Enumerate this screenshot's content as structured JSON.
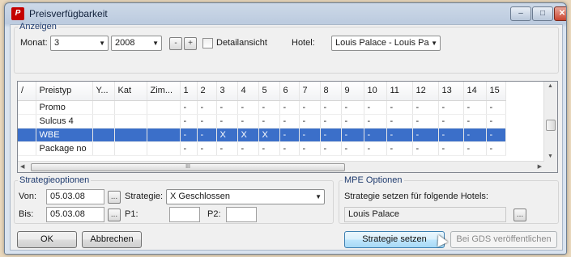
{
  "window": {
    "title": "Preisverfügbarkeit",
    "app_icon_text": "P",
    "min": "–",
    "max": "□",
    "close": "✕"
  },
  "anzeigen": {
    "legend": "Anzeigen",
    "monat_label": "Monat:",
    "monat_value": "3",
    "year_value": "2008",
    "minus": "-",
    "plus": "+",
    "detail_label": "Detailansicht",
    "hotel_label": "Hotel:",
    "hotel_value": "Louis Palace - Louis Pa"
  },
  "grid": {
    "columns": [
      "/",
      "Preistyp",
      "Y...",
      "Kat",
      "Zim...",
      "1",
      "2",
      "3",
      "4",
      "5",
      "6",
      "7",
      "8",
      "9",
      "10",
      "11",
      "12",
      "13",
      "14",
      "15"
    ],
    "rows": [
      {
        "cells": [
          "",
          "Promo",
          "",
          "",
          "",
          "-",
          "-",
          "-",
          "-",
          "-",
          "-",
          "-",
          "-",
          "-",
          "-",
          "-",
          "-",
          "-",
          "-",
          "-"
        ],
        "selected": false
      },
      {
        "cells": [
          "",
          "Sulcus 4",
          "",
          "",
          "",
          "-",
          "-",
          "-",
          "-",
          "-",
          "-",
          "-",
          "-",
          "-",
          "-",
          "-",
          "-",
          "-",
          "-",
          "-"
        ],
        "selected": false
      },
      {
        "cells": [
          "",
          "WBE",
          "",
          "",
          "",
          "-",
          "-",
          "X",
          "X",
          "X",
          "-",
          "-",
          "-",
          "-",
          "-",
          "-",
          "-",
          "-",
          "-",
          "-"
        ],
        "selected": true
      },
      {
        "cells": [
          "",
          "Package no",
          "",
          "",
          "",
          "-",
          "-",
          "-",
          "-",
          "-",
          "-",
          "-",
          "-",
          "-",
          "-",
          "-",
          "-",
          "-",
          "-",
          "-"
        ],
        "selected": false
      }
    ],
    "hscroll_grip": "III"
  },
  "strategie": {
    "legend": "Strategieoptionen",
    "von_label": "Von:",
    "von_value": "05.03.08",
    "bis_label": "Bis:",
    "bis_value": "05.03.08",
    "picker": "...",
    "strategie_label": "Strategie:",
    "strategie_value": "X Geschlossen",
    "p1_label": "P1:",
    "p1_value": "",
    "p2_label": "P2:",
    "p2_value": ""
  },
  "mpe": {
    "legend": "MPE Optionen",
    "caption": "Strategie setzen für folgende Hotels:",
    "hotels_value": "Louis Palace",
    "picker": "..."
  },
  "buttons": {
    "ok": "OK",
    "abbrechen": "Abbrechen",
    "strategie_setzen": "Strategie setzen",
    "gds": "Bei GDS veröffentlichen"
  }
}
